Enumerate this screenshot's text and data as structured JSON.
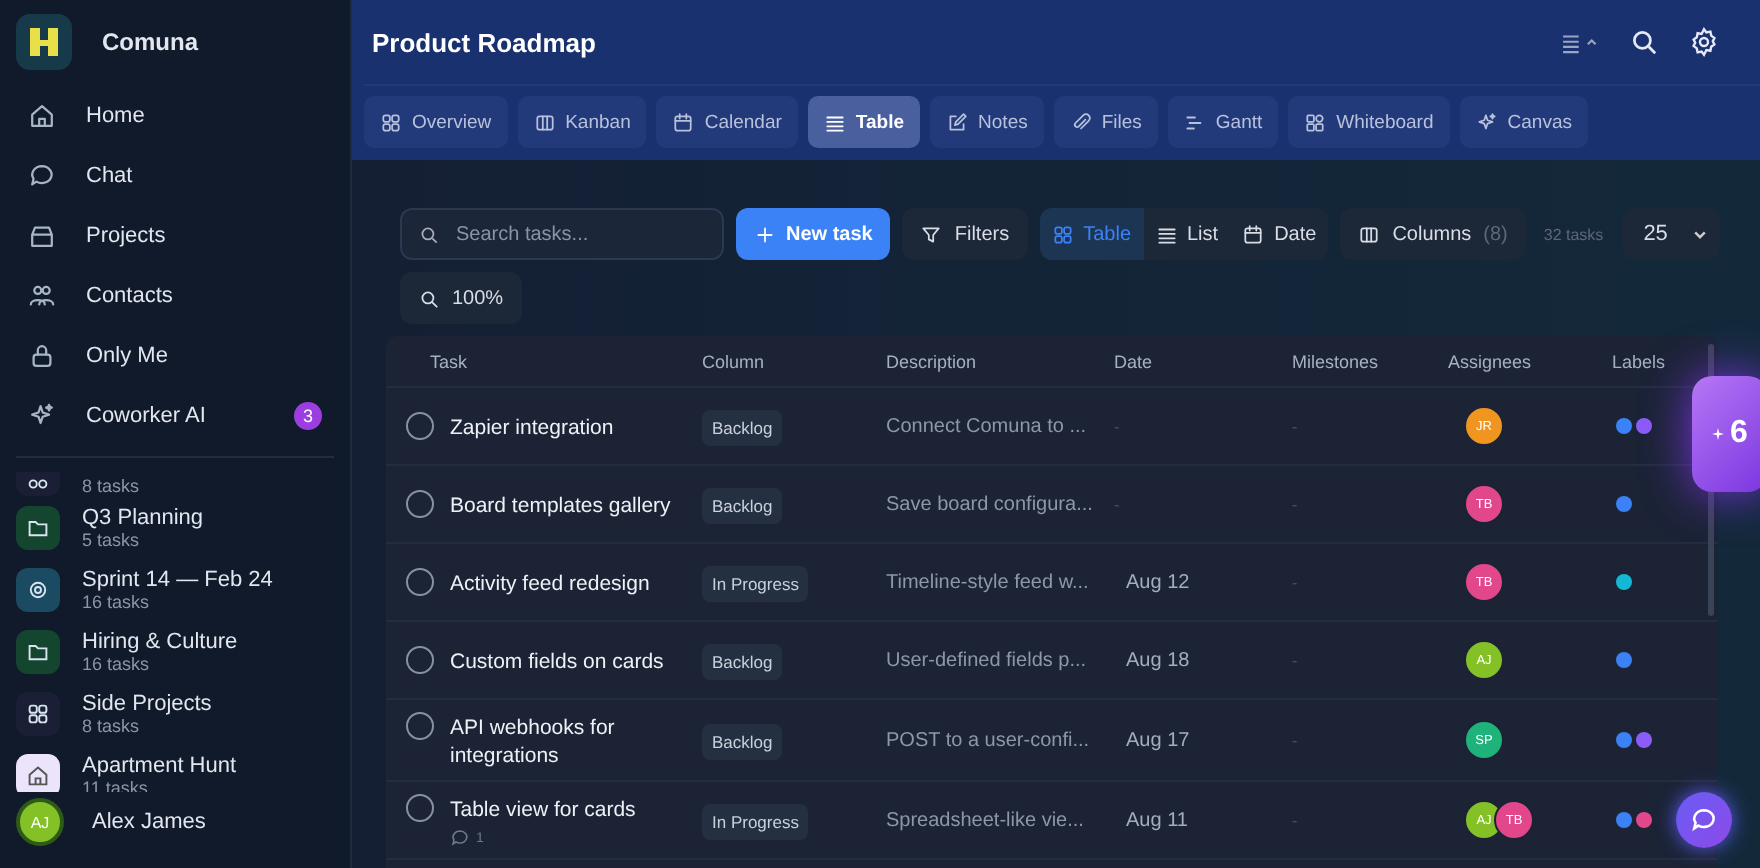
{
  "app": {
    "name": "Comuna"
  },
  "nav": [
    {
      "label": "Home",
      "kind": "home"
    },
    {
      "label": "Chat",
      "kind": "chat"
    },
    {
      "label": "Projects",
      "kind": "box"
    },
    {
      "label": "Contacts",
      "kind": "people"
    },
    {
      "label": "Only Me",
      "kind": "lock"
    },
    {
      "label": "Coworker AI",
      "kind": "sparkle",
      "badge": "3"
    }
  ],
  "projects": [
    {
      "count": "8 tasks",
      "kind": "loop",
      "color": "#1a1f35"
    },
    {
      "name": "Q3 Planning",
      "count": "5 tasks",
      "kind": "folder",
      "color": "#14452f"
    },
    {
      "name": "Sprint 14 — Feb 24",
      "count": "16 tasks",
      "kind": "target",
      "color": "#1b4a63"
    },
    {
      "name": "Hiring & Culture",
      "count": "16 tasks",
      "kind": "folder",
      "color": "#14452f"
    },
    {
      "name": "Side Projects",
      "count": "8 tasks",
      "kind": "grid",
      "color": "#1a1f35"
    },
    {
      "name": "Apartment Hunt",
      "count": "11 tasks",
      "kind": "home",
      "color": "#ece4fb"
    }
  ],
  "user": {
    "initials": "AJ",
    "name": "Alex James"
  },
  "page": {
    "title": "Product Roadmap"
  },
  "views": [
    {
      "label": "Overview",
      "kind": "grid",
      "selected": false
    },
    {
      "label": "Kanban",
      "kind": "columns",
      "selected": false
    },
    {
      "label": "Calendar",
      "kind": "calendar",
      "selected": false
    },
    {
      "label": "Table",
      "kind": "list",
      "selected": true
    },
    {
      "label": "Notes",
      "kind": "edit",
      "selected": false
    },
    {
      "label": "Files",
      "kind": "clip",
      "selected": false
    },
    {
      "label": "Gantt",
      "kind": "gantt",
      "selected": false
    },
    {
      "label": "Whiteboard",
      "kind": "shapes",
      "selected": false
    },
    {
      "label": "Canvas",
      "kind": "sparkle",
      "selected": false
    }
  ],
  "toolbar": {
    "search": {
      "placeholder": "Search tasks..."
    },
    "new_task": "New task",
    "filters": "Filters",
    "layouts": [
      {
        "label": "Table",
        "kind": "grid",
        "selected": true
      },
      {
        "label": "List",
        "kind": "list",
        "selected": false
      },
      {
        "label": "Date",
        "kind": "calendar",
        "selected": false
      }
    ],
    "columns": "Columns",
    "columns_count": "(8)",
    "task_count": "32 tasks",
    "page_size": "25",
    "zoom": "100%"
  },
  "table": {
    "columns": [
      "Task",
      "Column",
      "Description",
      "Date",
      "Milestones",
      "Assignees",
      "Labels"
    ],
    "rows": [
      {
        "checked": false,
        "task": "Zapier integration",
        "column": "Backlog",
        "description": "Connect Comuna to ...",
        "date": "-",
        "milestones": "-",
        "assignees": [
          {
            "initials": "JR",
            "color": "#f0951f"
          }
        ],
        "labels": [
          {
            "color": "#3b82f6"
          },
          {
            "color": "#8b5cf6"
          }
        ]
      },
      {
        "checked": false,
        "task": "Board templates gallery",
        "column": "Backlog",
        "description": "Save board configura...",
        "date": "-",
        "milestones": "-",
        "assignees": [
          {
            "initials": "TB",
            "color": "#e2468b"
          }
        ],
        "labels": [
          {
            "color": "#3b82f6"
          }
        ]
      },
      {
        "checked": false,
        "task": "Activity feed redesign",
        "column": "In Progress",
        "description": "Timeline-style feed w...",
        "date": "Aug 12",
        "milestones": "-",
        "assignees": [
          {
            "initials": "TB",
            "color": "#e2468b"
          }
        ],
        "labels": [
          {
            "color": "#14b8d4"
          }
        ]
      },
      {
        "checked": false,
        "task": "Custom fields on cards",
        "column": "Backlog",
        "description": "User-defined fields p...",
        "date": "Aug 18",
        "milestones": "-",
        "assignees": [
          {
            "initials": "AJ",
            "color": "#84c126"
          }
        ],
        "labels": [
          {
            "color": "#3b82f6"
          }
        ]
      },
      {
        "checked": false,
        "task": "API webhooks for integrations",
        "column": "Backlog",
        "description": "POST to a user-confi...",
        "date": "Aug 17",
        "milestones": "-",
        "assignees": [
          {
            "initials": "SP",
            "color": "#1fb27a"
          }
        ],
        "labels": [
          {
            "color": "#3b82f6"
          },
          {
            "color": "#8b5cf6"
          }
        ]
      },
      {
        "checked": false,
        "task": "Table view for cards",
        "comments": "1",
        "column": "In Progress",
        "description": "Spreadsheet-like vie...",
        "date": "Aug 11",
        "milestones": "-",
        "assignees": [
          {
            "initials": "AJ",
            "color": "#84c126"
          },
          {
            "initials": "TB",
            "color": "#e2468b"
          }
        ],
        "labels": [
          {
            "color": "#3b82f6"
          },
          {
            "color": "#e2468b"
          }
        ]
      }
    ]
  },
  "floating_badge": "6"
}
